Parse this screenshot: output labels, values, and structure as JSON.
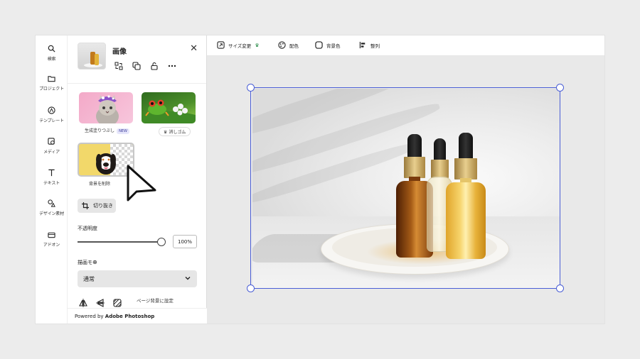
{
  "rail": {
    "items": [
      {
        "label": "検索",
        "icon": "search-icon"
      },
      {
        "label": "プロジェクト",
        "icon": "folder-icon"
      },
      {
        "label": "テンプレート",
        "icon": "template-icon"
      },
      {
        "label": "メディア",
        "icon": "media-icon"
      },
      {
        "label": "テキスト",
        "icon": "text-icon"
      },
      {
        "label": "デザイン素材",
        "icon": "shapes-icon"
      },
      {
        "label": "アドオン",
        "icon": "addon-icon"
      }
    ]
  },
  "panel": {
    "title": "画像",
    "close": "✕",
    "tiles": [
      {
        "caption": "生成塗りつぶし",
        "badge": "NEW"
      },
      {
        "caption": "消しゴム"
      },
      {
        "caption": "背景を削除"
      }
    ],
    "crop_label": "切り抜き",
    "opacity_label": "不透明度",
    "opacity_value": "100%",
    "opacity_level": 1.0,
    "blend_label": "描画モ",
    "blend_value": "通常",
    "page_bg_label": "ページ背景に設定",
    "powered_prefix": "Powered by ",
    "powered_brand": "Adobe Photoshop"
  },
  "toolbar": {
    "resize": "サイズ変更",
    "color": "配色",
    "bg_color": "背景色",
    "align": "整列"
  },
  "colors": {
    "accent": "#4a5ed6",
    "premium": "#2f8f4e"
  }
}
